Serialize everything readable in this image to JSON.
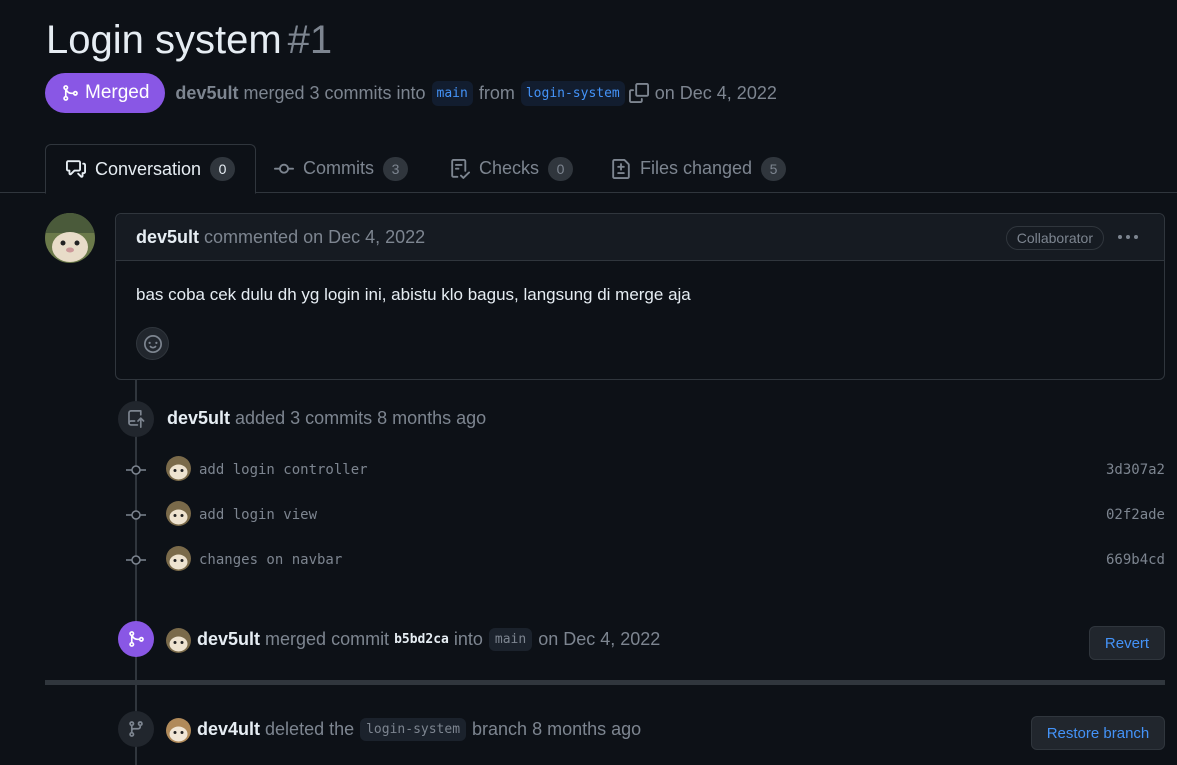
{
  "pr": {
    "title": "Login system",
    "number": "#1",
    "state": "Merged",
    "author": "dev5ult",
    "merged_text": "merged 3 commits into",
    "base_branch": "main",
    "from_text": "from",
    "head_branch": "login-system",
    "date_text": "on Dec 4, 2022"
  },
  "tabs": [
    {
      "label": "Conversation",
      "count": "0",
      "icon": "comment-discussion-icon"
    },
    {
      "label": "Commits",
      "count": "3",
      "icon": "git-commit-icon"
    },
    {
      "label": "Checks",
      "count": "0",
      "icon": "checklist-icon"
    },
    {
      "label": "Files changed",
      "count": "5",
      "icon": "file-diff-icon"
    }
  ],
  "comment": {
    "author": "dev5ult",
    "meta": "commented on Dec 4, 2022",
    "role_badge": "Collaborator",
    "body": "bas coba cek dulu dh yg login ini, abistu klo bagus, langsung di merge aja"
  },
  "timeline": {
    "added": {
      "author": "dev5ult",
      "text": "added 3 commits 8 months ago"
    },
    "commits": [
      {
        "message": "add login controller",
        "sha": "3d307a2"
      },
      {
        "message": "add login view",
        "sha": "02f2ade"
      },
      {
        "message": "changes on navbar",
        "sha": "669b4cd"
      }
    ],
    "merged": {
      "author": "dev5ult",
      "text1": "merged commit",
      "sha": "b5bd2ca",
      "text2": "into",
      "branch": "main",
      "date": "on Dec 4, 2022",
      "button": "Revert"
    },
    "deleted": {
      "author": "dev4ult",
      "text1": "deleted the",
      "branch": "login-system",
      "text2": "branch 8 months ago",
      "button": "Restore branch"
    }
  },
  "colors": {
    "background": "#0d1117",
    "merged_purple": "#8957e5",
    "link_blue": "#4493f8",
    "muted": "#7d8590",
    "border": "#30363d"
  }
}
